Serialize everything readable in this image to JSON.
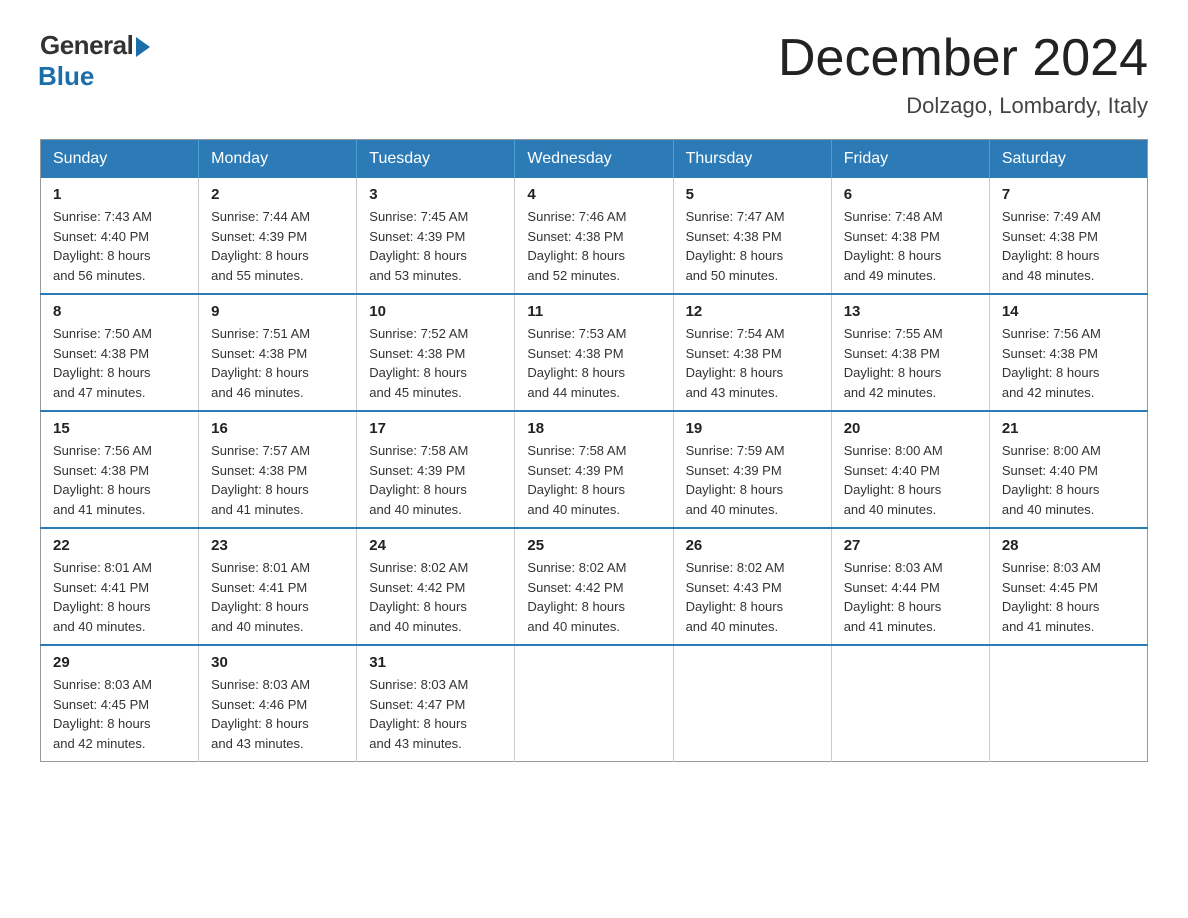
{
  "logo": {
    "general": "General",
    "blue": "Blue"
  },
  "title": {
    "month_year": "December 2024",
    "location": "Dolzago, Lombardy, Italy"
  },
  "weekdays": [
    "Sunday",
    "Monday",
    "Tuesday",
    "Wednesday",
    "Thursday",
    "Friday",
    "Saturday"
  ],
  "weeks": [
    [
      {
        "day": "1",
        "sunrise": "7:43 AM",
        "sunset": "4:40 PM",
        "daylight": "8 hours and 56 minutes."
      },
      {
        "day": "2",
        "sunrise": "7:44 AM",
        "sunset": "4:39 PM",
        "daylight": "8 hours and 55 minutes."
      },
      {
        "day": "3",
        "sunrise": "7:45 AM",
        "sunset": "4:39 PM",
        "daylight": "8 hours and 53 minutes."
      },
      {
        "day": "4",
        "sunrise": "7:46 AM",
        "sunset": "4:38 PM",
        "daylight": "8 hours and 52 minutes."
      },
      {
        "day": "5",
        "sunrise": "7:47 AM",
        "sunset": "4:38 PM",
        "daylight": "8 hours and 50 minutes."
      },
      {
        "day": "6",
        "sunrise": "7:48 AM",
        "sunset": "4:38 PM",
        "daylight": "8 hours and 49 minutes."
      },
      {
        "day": "7",
        "sunrise": "7:49 AM",
        "sunset": "4:38 PM",
        "daylight": "8 hours and 48 minutes."
      }
    ],
    [
      {
        "day": "8",
        "sunrise": "7:50 AM",
        "sunset": "4:38 PM",
        "daylight": "8 hours and 47 minutes."
      },
      {
        "day": "9",
        "sunrise": "7:51 AM",
        "sunset": "4:38 PM",
        "daylight": "8 hours and 46 minutes."
      },
      {
        "day": "10",
        "sunrise": "7:52 AM",
        "sunset": "4:38 PM",
        "daylight": "8 hours and 45 minutes."
      },
      {
        "day": "11",
        "sunrise": "7:53 AM",
        "sunset": "4:38 PM",
        "daylight": "8 hours and 44 minutes."
      },
      {
        "day": "12",
        "sunrise": "7:54 AM",
        "sunset": "4:38 PM",
        "daylight": "8 hours and 43 minutes."
      },
      {
        "day": "13",
        "sunrise": "7:55 AM",
        "sunset": "4:38 PM",
        "daylight": "8 hours and 42 minutes."
      },
      {
        "day": "14",
        "sunrise": "7:56 AM",
        "sunset": "4:38 PM",
        "daylight": "8 hours and 42 minutes."
      }
    ],
    [
      {
        "day": "15",
        "sunrise": "7:56 AM",
        "sunset": "4:38 PM",
        "daylight": "8 hours and 41 minutes."
      },
      {
        "day": "16",
        "sunrise": "7:57 AM",
        "sunset": "4:38 PM",
        "daylight": "8 hours and 41 minutes."
      },
      {
        "day": "17",
        "sunrise": "7:58 AM",
        "sunset": "4:39 PM",
        "daylight": "8 hours and 40 minutes."
      },
      {
        "day": "18",
        "sunrise": "7:58 AM",
        "sunset": "4:39 PM",
        "daylight": "8 hours and 40 minutes."
      },
      {
        "day": "19",
        "sunrise": "7:59 AM",
        "sunset": "4:39 PM",
        "daylight": "8 hours and 40 minutes."
      },
      {
        "day": "20",
        "sunrise": "8:00 AM",
        "sunset": "4:40 PM",
        "daylight": "8 hours and 40 minutes."
      },
      {
        "day": "21",
        "sunrise": "8:00 AM",
        "sunset": "4:40 PM",
        "daylight": "8 hours and 40 minutes."
      }
    ],
    [
      {
        "day": "22",
        "sunrise": "8:01 AM",
        "sunset": "4:41 PM",
        "daylight": "8 hours and 40 minutes."
      },
      {
        "day": "23",
        "sunrise": "8:01 AM",
        "sunset": "4:41 PM",
        "daylight": "8 hours and 40 minutes."
      },
      {
        "day": "24",
        "sunrise": "8:02 AM",
        "sunset": "4:42 PM",
        "daylight": "8 hours and 40 minutes."
      },
      {
        "day": "25",
        "sunrise": "8:02 AM",
        "sunset": "4:42 PM",
        "daylight": "8 hours and 40 minutes."
      },
      {
        "day": "26",
        "sunrise": "8:02 AM",
        "sunset": "4:43 PM",
        "daylight": "8 hours and 40 minutes."
      },
      {
        "day": "27",
        "sunrise": "8:03 AM",
        "sunset": "4:44 PM",
        "daylight": "8 hours and 41 minutes."
      },
      {
        "day": "28",
        "sunrise": "8:03 AM",
        "sunset": "4:45 PM",
        "daylight": "8 hours and 41 minutes."
      }
    ],
    [
      {
        "day": "29",
        "sunrise": "8:03 AM",
        "sunset": "4:45 PM",
        "daylight": "8 hours and 42 minutes."
      },
      {
        "day": "30",
        "sunrise": "8:03 AM",
        "sunset": "4:46 PM",
        "daylight": "8 hours and 43 minutes."
      },
      {
        "day": "31",
        "sunrise": "8:03 AM",
        "sunset": "4:47 PM",
        "daylight": "8 hours and 43 minutes."
      },
      null,
      null,
      null,
      null
    ]
  ],
  "labels": {
    "sunrise": "Sunrise:",
    "sunset": "Sunset:",
    "daylight": "Daylight:"
  }
}
